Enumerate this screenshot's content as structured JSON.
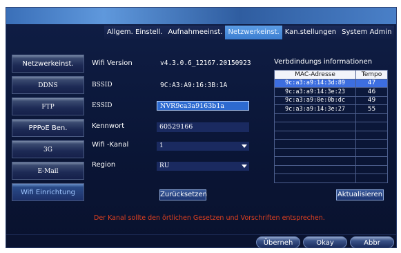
{
  "tabs": [
    {
      "label": "Allgem. Einstell."
    },
    {
      "label": "Aufnahmeeinst."
    },
    {
      "label": "Netzwerkeinst.",
      "active": true
    },
    {
      "label": "Kan.stellungen"
    },
    {
      "label": "System Admin"
    }
  ],
  "sidebar": {
    "items": [
      {
        "label": "Netzwerkeinst."
      },
      {
        "label": "DDNS"
      },
      {
        "label": "FTP"
      },
      {
        "label": "PPPoE Ben."
      },
      {
        "label": "3G"
      },
      {
        "label": "E-Mail"
      },
      {
        "label": "Wifi Einrichtung",
        "active": true
      }
    ]
  },
  "form": {
    "wifi_version_label": "Wifi Version",
    "wifi_version_value": "v4.3.0.6_12167.20150923",
    "bssid_label": "BSSID",
    "bssid_value": "9C:A3:A9:16:3B:1A",
    "essid_label": "ESSID",
    "essid_value": "NVR9ca3a9163b1a",
    "password_label": "Kennwort",
    "password_value": "60529166",
    "channel_label": "Wifi -Kanal",
    "channel_value": "1",
    "region_label": "Region",
    "region_value": "RU",
    "reset_button": "Zurücksetzen",
    "warning": "Der Kanal sollte den örtlichen Gesetzen und Vorschriften entsprechen."
  },
  "connections": {
    "title": "Verbdindungs informationen",
    "headers": {
      "mac": "MAC-Adresse",
      "tempo": "Tempo"
    },
    "rows": [
      {
        "mac": "9c:a3:a9:14:3d:89",
        "tempo": "47",
        "selected": true
      },
      {
        "mac": "9c:a3:a9:14:3e:23",
        "tempo": "46"
      },
      {
        "mac": "9c:a3:a9:0e:0b:dc",
        "tempo": "49"
      },
      {
        "mac": "9c:a3:a9:14:3e:27",
        "tempo": "55"
      }
    ],
    "refresh_button": "Aktualisieren"
  },
  "footer": {
    "apply_button": "Überneh",
    "ok_button": "Okay",
    "cancel_button": "Abbr"
  }
}
